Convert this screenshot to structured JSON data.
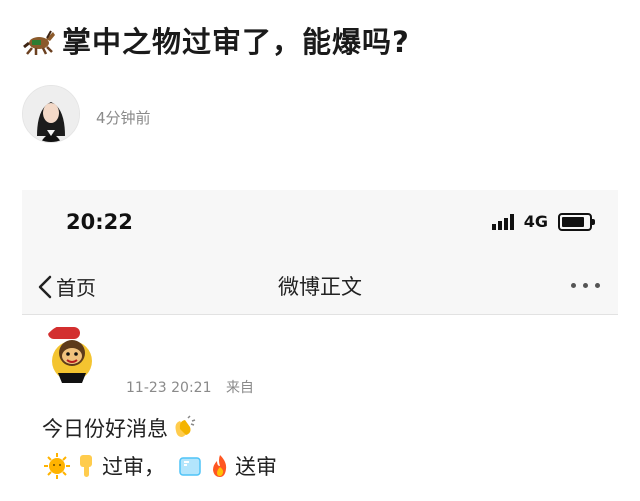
{
  "post": {
    "title": "掌中之物过审了，能爆吗?",
    "time": "4分钟前",
    "title_icon": "horse-emoji"
  },
  "screenshot": {
    "status_bar": {
      "time": "20:22",
      "network": "4G",
      "icons": [
        "signal-icon",
        "battery-icon"
      ]
    },
    "nav": {
      "back_label": "首页",
      "title": "微博正文",
      "more_icon": "more-icon"
    },
    "weibo": {
      "date": "11-23 20:21",
      "source": "来自",
      "line1_text": "今日份好消息",
      "line2_text_a": "过审，",
      "line2_text_b": "送审",
      "emojis": [
        "clap-emoji",
        "sun-emoji",
        "point-down-emoji",
        "ice-emoji",
        "fire-emoji"
      ]
    }
  },
  "colors": {
    "meta_gray": "#8a8a8a",
    "text_dark": "#222222",
    "screenshot_bg": "#f7f7f7"
  }
}
